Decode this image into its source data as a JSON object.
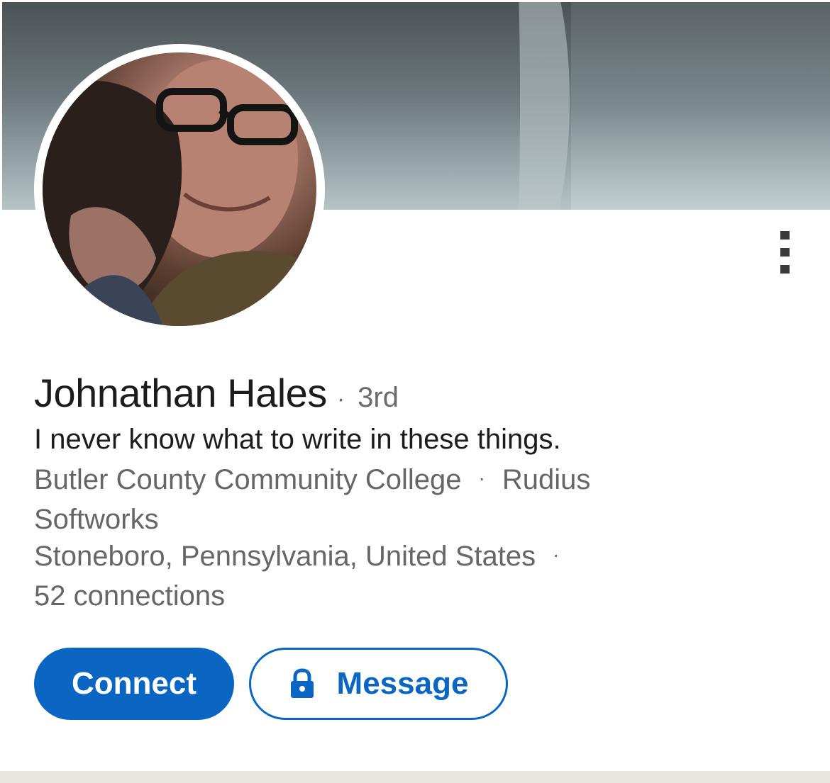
{
  "profile": {
    "name": "Johnathan Hales",
    "name_separator": "·",
    "connection_degree": "3rd",
    "headline": "I never know what to write in these things.",
    "education": "Butler County Community College",
    "meta_separator": "·",
    "company": "Rudius Softworks",
    "location": "Stoneboro, Pennsylvania, United States",
    "connections": "52 connections"
  },
  "actions": {
    "connect_label": "Connect",
    "message_label": "Message"
  },
  "icons": {
    "more": "more-vertical-icon",
    "lock": "lock-icon"
  },
  "colors": {
    "accent": "#0a66c2",
    "text_primary": "#1c1c1c",
    "text_secondary": "#666666"
  }
}
